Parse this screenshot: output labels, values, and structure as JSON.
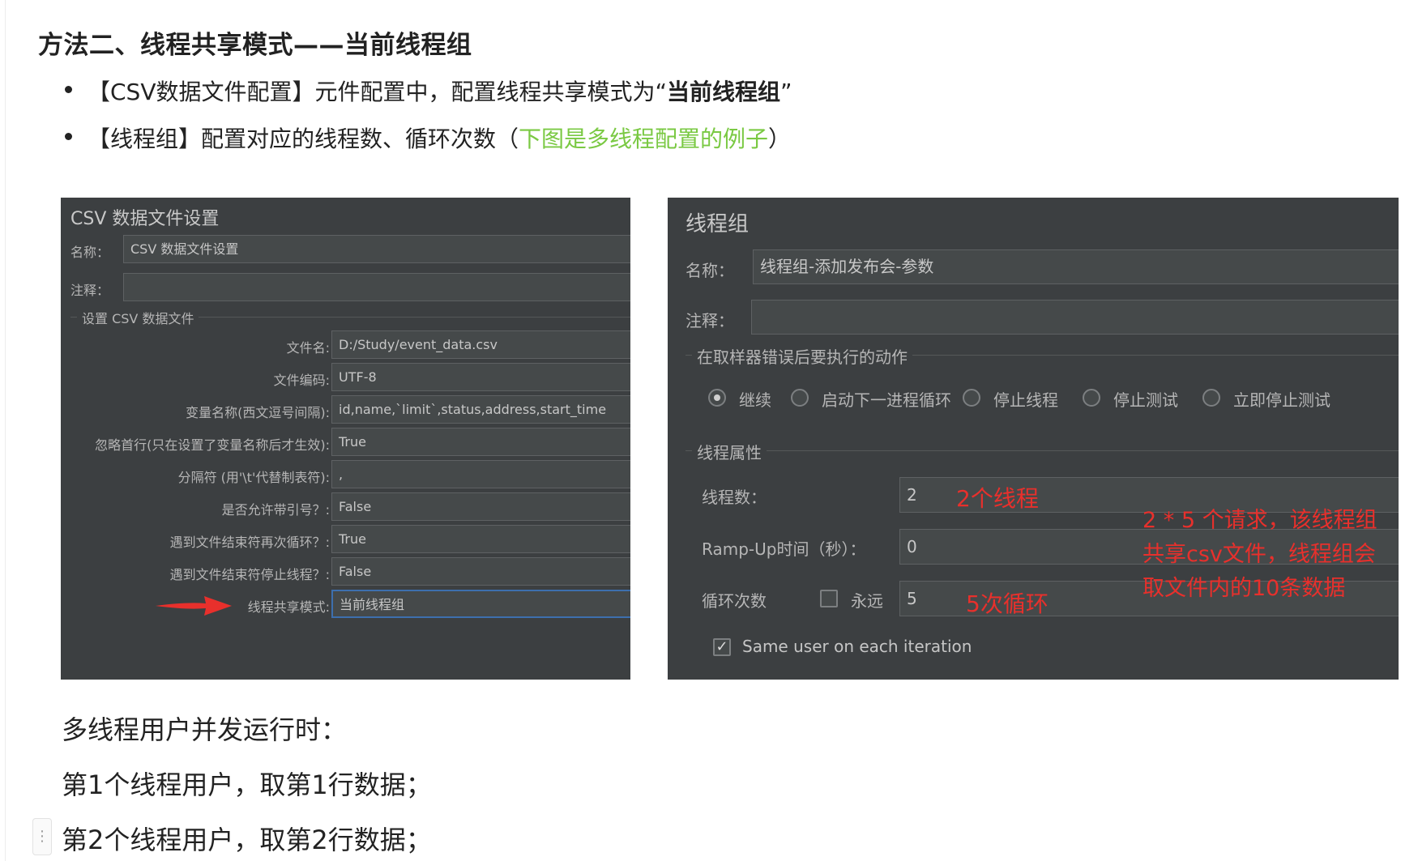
{
  "heading": "方法二、线程共享模式——当前线程组",
  "bullets": [
    {
      "pre": "【CSV数据文件配置】元件配置中，配置线程共享模式为“",
      "bold": "当前线程组",
      "post": "”"
    },
    {
      "pre": "【线程组】配置对应的线程数、循环次数（",
      "green": "下图是多线程配置的例子",
      "post": "）"
    }
  ],
  "csv_panel": {
    "title": "CSV 数据文件设置",
    "name_label": "名称：",
    "name_value": "CSV 数据文件设置",
    "comment_label": "注释：",
    "comment_value": "",
    "group_title": "设置 CSV 数据文件",
    "rows": [
      {
        "label": "文件名:",
        "value": "D:/Study/event_data.csv"
      },
      {
        "label": "文件编码:",
        "value": "UTF-8"
      },
      {
        "label": "变量名称(西文逗号间隔):",
        "value": "id,name,`limit`,status,address,start_time"
      },
      {
        "label": "忽略首行(只在设置了变量名称后才生效):",
        "value": "True"
      },
      {
        "label": "分隔符 (用'\\t'代替制表符):",
        "value": ","
      },
      {
        "label": "是否允许带引号？:",
        "value": "False"
      },
      {
        "label": "遇到文件结束符再次循环？:",
        "value": "True"
      },
      {
        "label": "遇到文件结束符停止线程？:",
        "value": "False"
      },
      {
        "label": "线程共享模式:",
        "value": "当前线程组"
      }
    ]
  },
  "thread_panel": {
    "title": "线程组",
    "name_label": "名称：",
    "name_value": "线程组-添加发布会-参数",
    "comment_label": "注释：",
    "comment_value": "",
    "action_group_title": "在取样器错误后要执行的动作",
    "actions": [
      {
        "label": "继续",
        "selected": true
      },
      {
        "label": "启动下一进程循环",
        "selected": false
      },
      {
        "label": "停止线程",
        "selected": false
      },
      {
        "label": "停止测试",
        "selected": false
      },
      {
        "label": "立即停止测试",
        "selected": false
      }
    ],
    "props_group_title": "线程属性",
    "threads_label": "线程数：",
    "threads_value": "2",
    "rampup_label": "Ramp-Up时间（秒）：",
    "rampup_value": "0",
    "loop_label": "循环次数",
    "forever_label": "永远",
    "forever_checked": false,
    "loop_value": "5",
    "same_user_label": "Same user on each iteration",
    "same_user_checked": true
  },
  "annotations": {
    "threads_note": "2个线程",
    "loop_note": "5次循环",
    "summary_lines": [
      "2 * 5 个请求，该线程组",
      "共享csv文件，线程组会",
      "取文件内的10条数据"
    ],
    "accent_color": "#e8302c"
  },
  "paragraphs": [
    "多线程用户并发运行时：",
    "第1个线程用户，取第1行数据；",
    "第2个线程用户，取第2行数据；"
  ],
  "drag_handle_glyph": "⋮"
}
